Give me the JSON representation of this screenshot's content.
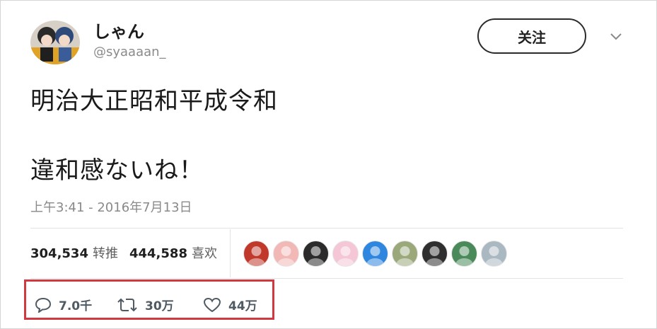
{
  "user": {
    "name": "しゃん",
    "handle": "@syaaaan_"
  },
  "follow_button": "关注",
  "tweet": {
    "line1": "明治大正昭和平成令和",
    "line2": "違和感ないね！",
    "timestamp": "上午3:41 - 2016年7月13日"
  },
  "stats": {
    "retweets_count": "304,534",
    "retweets_label": "转推",
    "likes_count": "444,588",
    "likes_label": "喜欢"
  },
  "likers": [
    {
      "icon": "liker-avatar-1",
      "color": "#c0392b"
    },
    {
      "icon": "liker-avatar-2",
      "color": "#f2b8b5"
    },
    {
      "icon": "liker-avatar-3",
      "color": "#2b2b2b"
    },
    {
      "icon": "liker-avatar-4",
      "color": "#f5c6d6"
    },
    {
      "icon": "liker-avatar-5",
      "color": "#2e86de"
    },
    {
      "icon": "liker-avatar-6",
      "color": "#9aa87a"
    },
    {
      "icon": "liker-avatar-7",
      "color": "#2f2f2f"
    },
    {
      "icon": "liker-avatar-8",
      "color": "#4a8a5a"
    },
    {
      "icon": "liker-avatar-9",
      "color": "#aab8c2"
    }
  ],
  "actions": {
    "reply_count": "7.0千",
    "retweet_count": "30万",
    "like_count": "44万"
  },
  "colors": {
    "highlight_border": "#d2383f",
    "muted_text": "#8a8a8a"
  }
}
